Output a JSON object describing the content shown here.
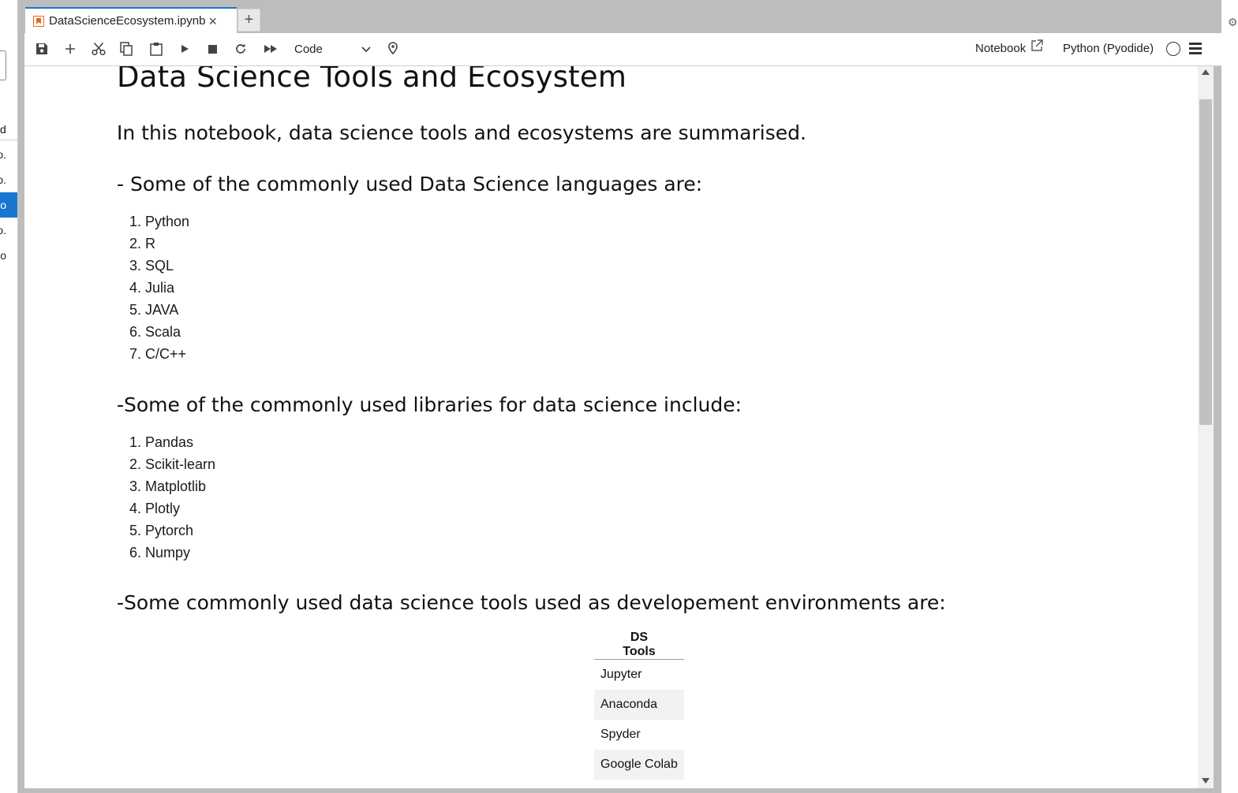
{
  "sidebar": {
    "header": "d",
    "items": [
      {
        "label": "o."
      },
      {
        "label": "o."
      },
      {
        "label": "o",
        "selected": true
      },
      {
        "label": "o."
      },
      {
        "label": "o"
      }
    ]
  },
  "tab": {
    "title": "DataScienceEcosystem.ipynb",
    "close": "×",
    "add": "+"
  },
  "toolbar": {
    "cell_type": "Code",
    "notebook_label": "Notebook",
    "kernel_label": "Python (Pyodide)",
    "icons": [
      "save-icon",
      "add-cell-icon",
      "cut-icon",
      "copy-icon",
      "paste-icon",
      "run-icon",
      "stop-icon",
      "restart-icon",
      "run-all-icon",
      "chevron-down-icon",
      "pin-icon",
      "external-link-icon",
      "kernel-status-icon",
      "menu-icon"
    ]
  },
  "notebook": {
    "title": "Data Science Tools and Ecosystem",
    "intro": "In this notebook, data science tools and ecosystems are summarised.",
    "languages_heading": "- Some of the commonly used Data Science languages are:",
    "languages": [
      "1. Python",
      "2. R",
      "3. SQL",
      "4. Julia",
      "5. JAVA",
      "6. Scala",
      "7. C/C++"
    ],
    "libraries_heading": "-Some of the commonly used libraries for data science include:",
    "libraries": [
      "1. Pandas",
      "2. Scikit-learn",
      "3. Matplotlib",
      "4. Plotly",
      "5. Pytorch",
      "6. Numpy"
    ],
    "tools_heading": "-Some commonly used data science tools used as developement environments are:",
    "tools_table": {
      "header": "DS Tools",
      "rows": [
        "Jupyter",
        "Anaconda",
        "Spyder",
        "Google Colab"
      ]
    }
  }
}
